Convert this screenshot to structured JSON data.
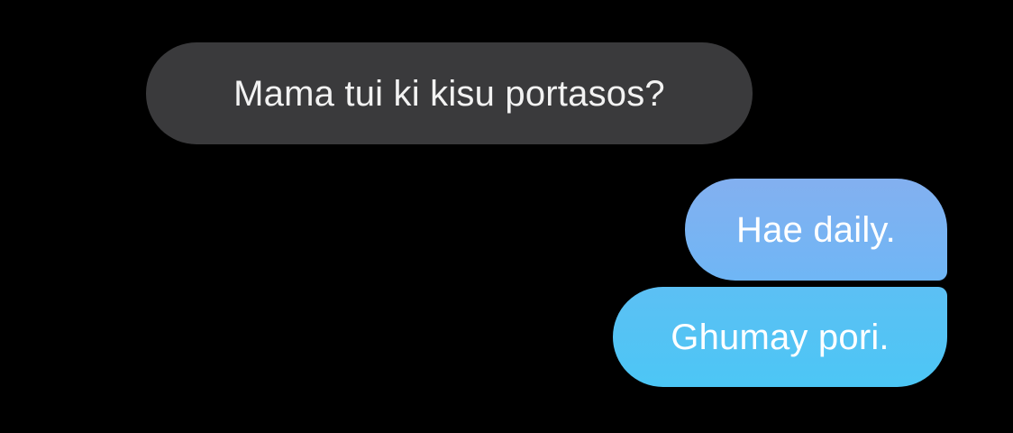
{
  "conversation": {
    "messages": [
      {
        "direction": "incoming",
        "text": "Mama tui ki kisu portasos?"
      },
      {
        "direction": "outgoing",
        "text": "Hae daily."
      },
      {
        "direction": "outgoing",
        "text": "Ghumay pori."
      }
    ]
  },
  "colors": {
    "background": "#000000",
    "incoming_bubble": "#3a3a3c",
    "outgoing_bubble_top": "#83b0f0",
    "outgoing_bubble_bottom": "#4cc6f5",
    "text": "#ffffff"
  }
}
